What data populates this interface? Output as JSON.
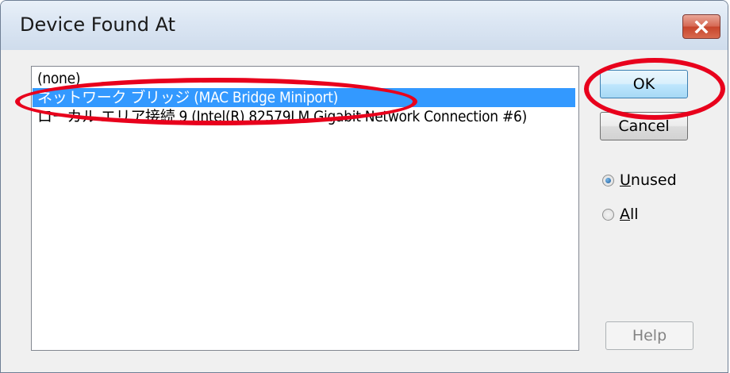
{
  "window": {
    "title": "Device Found At"
  },
  "list": {
    "items": [
      "(none)",
      "ネットワーク ブリッジ (MAC Bridge Miniport)",
      "ローカル エリア接続 9 (Intel(R) 82579LM Gigabit Network Connection #6)"
    ],
    "selected_index": 1
  },
  "buttons": {
    "ok": "OK",
    "cancel": "Cancel",
    "help": "Help"
  },
  "options": {
    "unused_prefix": "U",
    "unused_rest": "nused",
    "all_prefix": "A",
    "all_rest": "ll",
    "selected": "Unused"
  },
  "colors": {
    "selection": "#3399ff",
    "annotation": "#e8001c"
  },
  "icons": {
    "close": "close-icon"
  }
}
